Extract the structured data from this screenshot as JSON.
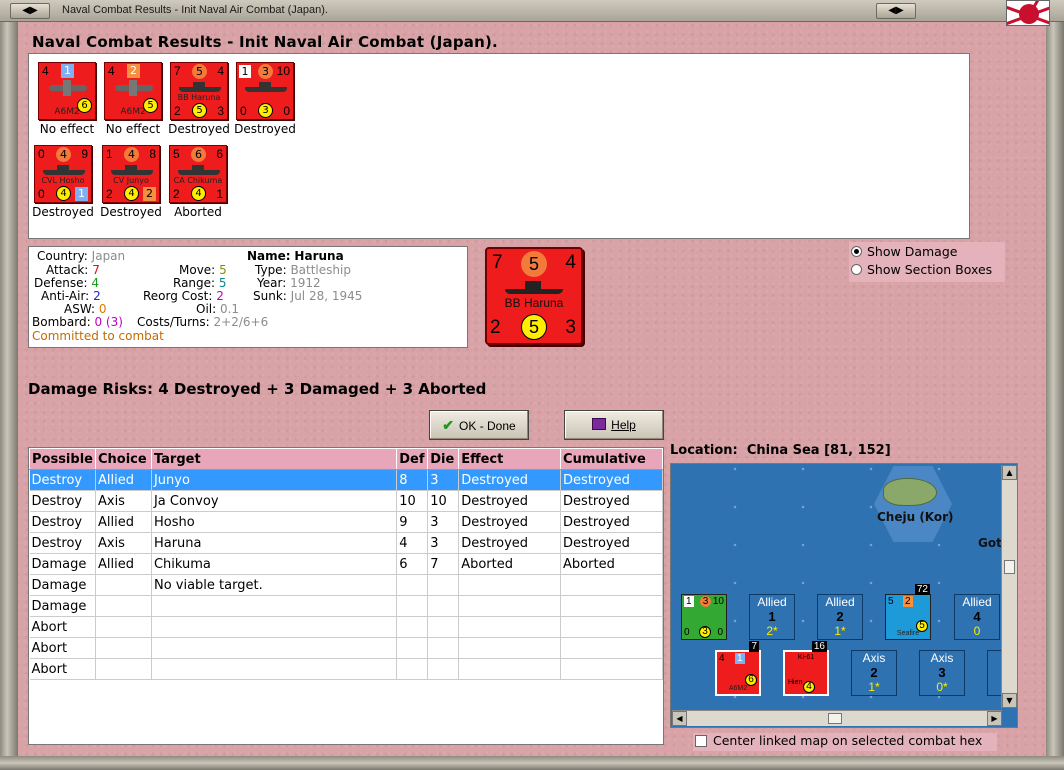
{
  "window": {
    "title": "Naval Combat Results - Init Naval Air Combat (Japan)."
  },
  "heading": "Naval Combat Results - Init Naval Air Combat (Japan).",
  "units": [
    {
      "name": "A6M2",
      "kind": "plane",
      "tl": "4",
      "badge": "1",
      "badge_kind": "blue",
      "yellow": "6",
      "result": "No effect"
    },
    {
      "name": "A6M2",
      "kind": "plane",
      "tl": "4",
      "badge": "2",
      "badge_kind": "orange",
      "yellow": "5",
      "result": "No effect"
    },
    {
      "name": "BB Haruna",
      "kind": "ship",
      "tl": "7",
      "circle": "5",
      "tr": "4",
      "bl": "2",
      "yellow": "5",
      "br": "3",
      "result": "Destroyed"
    },
    {
      "name": "",
      "kind": "ship",
      "white": "1",
      "circle": "3",
      "tr": "10",
      "bl": "0",
      "yellow": "3",
      "br": "0",
      "result": "Destroyed"
    },
    {
      "name": "CVL Hosho",
      "kind": "ship",
      "tl": "0",
      "circle": "4",
      "tr": "9",
      "bl": "0",
      "yellow": "4",
      "br": "1",
      "br_kind": "blue",
      "result": "Destroyed"
    },
    {
      "name": "CV Junyo",
      "kind": "ship",
      "tl": "1",
      "circle": "4",
      "tr": "8",
      "bl": "2",
      "yellow": "4",
      "br": "2",
      "br_kind": "orange",
      "result": "Destroyed"
    },
    {
      "name": "CA Chikuma",
      "kind": "ship",
      "tl": "5",
      "circle": "6",
      "tr": "6",
      "bl": "2",
      "yellow": "4",
      "br": "1",
      "result": "Aborted"
    }
  ],
  "info": {
    "country_label": "Country:",
    "country": "Japan",
    "attack_label": "Attack:",
    "attack": "7",
    "defense_label": "Defense:",
    "defense": "4",
    "antiair_label": "Anti-Air:",
    "antiair": "2",
    "asw_label": "ASW:",
    "asw": "0",
    "bombard_label": "Bombard:",
    "bombard": "0",
    "bombard_paren": "(3)",
    "committed": "Committed to combat",
    "move_label": "Move:",
    "move": "5",
    "range_label": "Range:",
    "range": "5",
    "reorg_label": "Reorg Cost:",
    "reorg": "2",
    "oil_label": "Oil:",
    "oil": "0.1",
    "costs_label": "Costs/Turns:",
    "costs": "2+2/6+6",
    "name_label": "Name:",
    "name": "Haruna",
    "type_label": "Type:",
    "type": "Battleship",
    "year_label": "Year:",
    "year": "1912",
    "sunk_label": "Sunk:",
    "sunk": "Jul 28, 1945"
  },
  "big_counter": {
    "tl": "7",
    "circle": "5",
    "tr": "4",
    "name": "BB Haruna",
    "bl": "2",
    "yellow": "5",
    "br": "3"
  },
  "radios": {
    "show_damage": "Show Damage",
    "show_section_boxes": "Show Section Boxes"
  },
  "damage_risks": "Damage Risks: 4 Destroyed + 3 Damaged + 3 Aborted",
  "buttons": {
    "ok": "OK - Done",
    "help": "Help"
  },
  "table": {
    "headers": [
      "Possible",
      "Choice",
      "Target",
      "Def",
      "Die",
      "Effect",
      "Cumulative"
    ],
    "rows": [
      [
        "Destroy",
        "Allied",
        "Junyo",
        "8",
        "3",
        "Destroyed",
        "Destroyed"
      ],
      [
        "Destroy",
        "Axis",
        "Ja Convoy",
        "10",
        "10",
        "Destroyed",
        "Destroyed"
      ],
      [
        "Destroy",
        "Allied",
        "Hosho",
        "9",
        "3",
        "Destroyed",
        "Destroyed"
      ],
      [
        "Destroy",
        "Axis",
        "Haruna",
        "4",
        "3",
        "Destroyed",
        "Destroyed"
      ],
      [
        "Damage",
        "Allied",
        "Chikuma",
        "6",
        "7",
        "Aborted",
        "Aborted"
      ],
      [
        "Damage",
        "",
        "No viable target.",
        "",
        "",
        "",
        ""
      ],
      [
        "Damage",
        "",
        "",
        "",
        "",
        "",
        ""
      ],
      [
        "Abort",
        "",
        "",
        "",
        "",
        "",
        ""
      ],
      [
        "Abort",
        "",
        "",
        "",
        "",
        "",
        ""
      ],
      [
        "Abort",
        "",
        "",
        "",
        "",
        "",
        ""
      ]
    ]
  },
  "location": {
    "label": "Location:",
    "value": "China Sea [81, 152]"
  },
  "map": {
    "place1": "Cheju (Kor)",
    "place2": "Got",
    "boxes": [
      {
        "side": "Allied",
        "num": "1",
        "sub": "2*"
      },
      {
        "side": "Allied",
        "num": "2",
        "sub": "1*"
      },
      {
        "side": "Allied",
        "num": "4",
        "sub": "0"
      },
      {
        "side": "Axis",
        "num": "2",
        "sub": "1*"
      },
      {
        "side": "Axis",
        "num": "3",
        "sub": "0*"
      }
    ],
    "counters": {
      "c72": "72",
      "c7": "7",
      "c16": "16",
      "seafire": "Seafire",
      "a6m2": "A6M2",
      "hien": "Hien",
      "ki61": "Ki-61",
      "green_tl": "1",
      "green_circle": "3",
      "green_tr": "10",
      "green_bl": "0",
      "green_yellow": "3",
      "green_br": "0",
      "sea_tl": "5",
      "sea_badge": "2",
      "sea_yellow": "5",
      "a6_tl": "4",
      "a6_badge": "1",
      "a6_yellow": "6",
      "hien_yellow": "4"
    }
  },
  "center_linked": "Center linked map on selected combat hex"
}
